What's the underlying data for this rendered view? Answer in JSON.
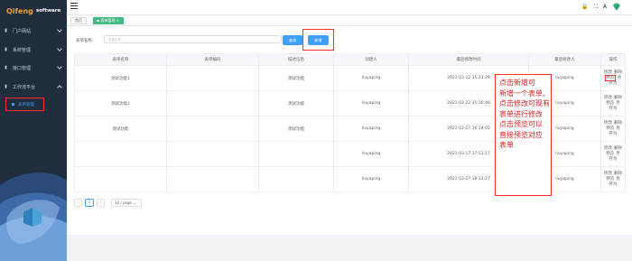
{
  "brand": {
    "logo": "Qifeng",
    "sub": "software"
  },
  "sidebar": {
    "items": [
      {
        "label": "门户网站",
        "icon": "home-icon"
      },
      {
        "label": "系统管理",
        "icon": "settings-icon"
      },
      {
        "label": "接口管理",
        "icon": "api-icon"
      },
      {
        "label": "工作流平台",
        "icon": "workflow-icon"
      }
    ],
    "submenu": {
      "label": "表单管理"
    }
  },
  "topbar": {
    "icons": [
      "lock-icon",
      "fullscreen-icon",
      "font-size-icon",
      "theme-gem-icon"
    ]
  },
  "tags": [
    {
      "label": "首页",
      "active": false
    },
    {
      "label": "表单管理",
      "active": true
    }
  ],
  "search": {
    "label": "表单名称:",
    "placeholder": "表单名称",
    "query_label": "查询",
    "add_label": "新增"
  },
  "table": {
    "headers": [
      "表单名称",
      "表单编码",
      "描述信息",
      "创建人",
      "最后修改时间",
      "最后修改人",
      "操作"
    ],
    "rows": [
      {
        "name": "测试功能1",
        "code": "",
        "desc": "测试功能",
        "creator": "liuyaping",
        "modified": "2021-03-22 15:21:29",
        "modifier": "liuyaping"
      },
      {
        "name": "测试功能2",
        "code": "",
        "desc": "测试功能",
        "creator": "liuyaping",
        "modified": "2021-03-22 15:30:46",
        "modifier": "liuyaping"
      },
      {
        "name": "测试功能",
        "code": "",
        "desc": "测试功能",
        "creator": "liuyaping",
        "modified": "2021-03-17 16:14:05",
        "modifier": "liuyaping"
      },
      {
        "name": "",
        "code": "",
        "desc": "",
        "creator": "liuyaping",
        "modified": "2021-03-17 17:53:17",
        "modifier": "liuyaping"
      },
      {
        "name": "",
        "code": "",
        "desc": "",
        "creator": "liuyaping",
        "modified": "2021-03-17 18:12:27",
        "modifier": "liuyaping"
      }
    ],
    "ops": {
      "edit": "修改",
      "delete": "删除",
      "preview": "预览",
      "copy": "另",
      "save_as": "存为"
    }
  },
  "annotation": "点击新增可\n新增一个表单,\n点击修改可现有\n表单进行修改\n点击预览可以\n直接预览对应\n表单",
  "pagination": {
    "current": "1",
    "page_size": "10 / page"
  }
}
